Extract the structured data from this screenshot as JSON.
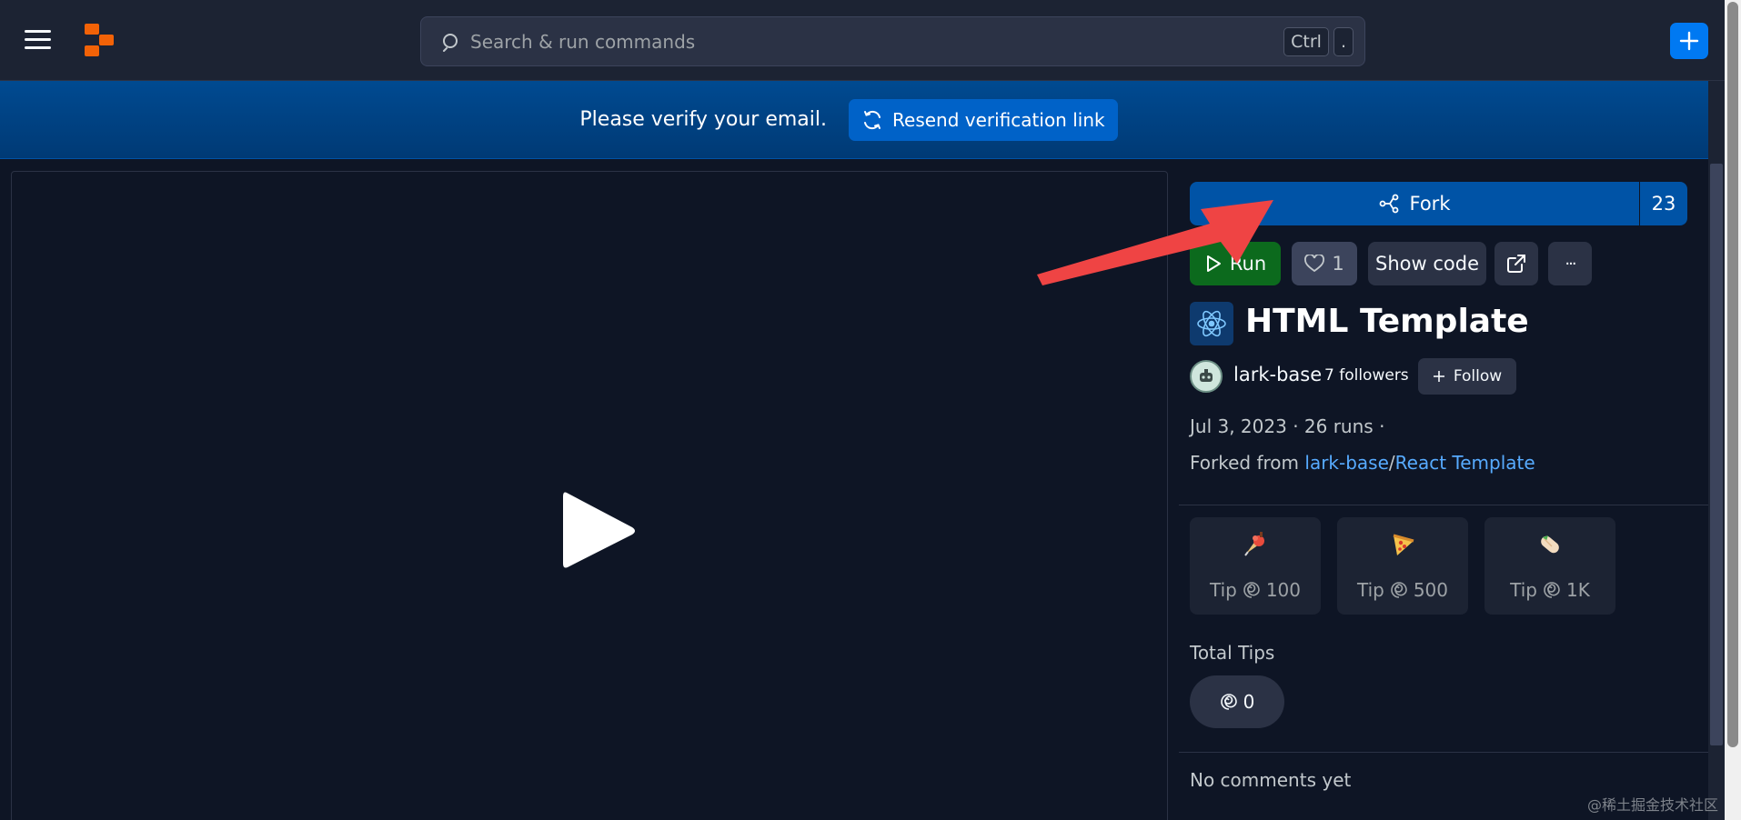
{
  "header": {
    "search_placeholder": "Search & run commands",
    "kbd_ctrl": "Ctrl",
    "kbd_dot": "."
  },
  "banner": {
    "text": "Please verify your email.",
    "resend_label": "Resend verification link"
  },
  "actions": {
    "fork_label": "Fork",
    "fork_count": "23",
    "run_label": "Run",
    "like_count": "1",
    "show_code_label": "Show code",
    "more_label": "···"
  },
  "repl": {
    "title": "HTML Template",
    "author": "lark-base",
    "followers": "7 followers",
    "follow_label": "Follow",
    "date": "Jul 3, 2023",
    "runs": "26 runs",
    "forked_prefix": "Forked from",
    "forked_user": "lark-base",
    "forked_sep": "/",
    "forked_repl": "React Template"
  },
  "tips": {
    "items": [
      {
        "emoji": "ice-cream-icon",
        "label": "Tip",
        "amount": "100"
      },
      {
        "emoji": "pizza-icon",
        "label": "Tip",
        "amount": "500"
      },
      {
        "emoji": "burrito-icon",
        "label": "Tip",
        "amount": "1K"
      }
    ],
    "total_label": "Total Tips",
    "total_value": "0"
  },
  "comments": {
    "empty_text": "No comments yet"
  },
  "watermark": "@稀土掘金技术社区",
  "colors": {
    "accent": "#0079f2",
    "fork": "#0053a6",
    "run": "#0c6a1d",
    "link": "#57abff",
    "logo": "#f26207"
  }
}
